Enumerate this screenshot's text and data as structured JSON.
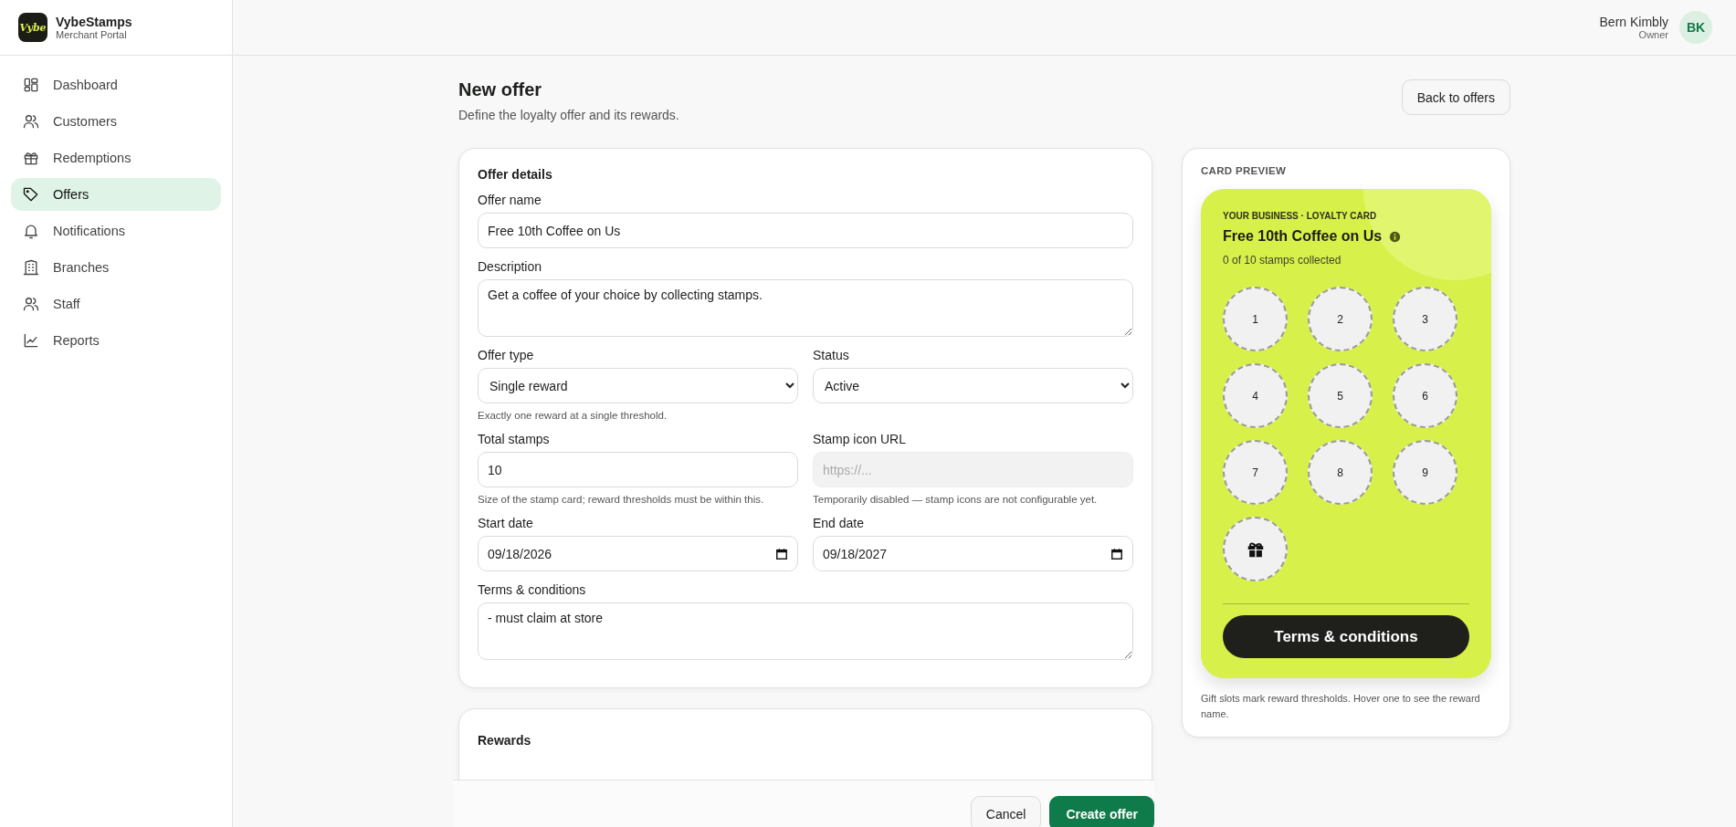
{
  "brand": {
    "logo_text": "Vybe",
    "name": "VybeStamps",
    "subtitle": "Merchant Portal"
  },
  "nav": [
    {
      "label": "Dashboard",
      "selected": false
    },
    {
      "label": "Customers",
      "selected": false
    },
    {
      "label": "Redemptions",
      "selected": false
    },
    {
      "label": "Offers",
      "selected": true
    },
    {
      "label": "Notifications",
      "selected": false
    },
    {
      "label": "Branches",
      "selected": false
    },
    {
      "label": "Staff",
      "selected": false
    },
    {
      "label": "Reports",
      "selected": false
    }
  ],
  "user": {
    "name": "Bern Kimbly",
    "role": "Owner",
    "initials": "BK"
  },
  "page": {
    "title": "New offer",
    "subtitle": "Define the loyalty offer and its rewards.",
    "back_button": "Back to offers"
  },
  "offer_details": {
    "title": "Offer details",
    "rows": [
      [
        {
          "kind": "text",
          "label": "Offer name",
          "value": "Free 10th Coffee on Us",
          "disabled": false
        }
      ],
      [
        {
          "kind": "textarea",
          "label": "Description",
          "value": "Get a coffee of your choice by collecting stamps.",
          "disabled": false
        }
      ],
      [
        {
          "kind": "select",
          "label": "Offer type",
          "value": "Single reward",
          "hint": "Exactly one reward at a single threshold.",
          "disabled": false
        },
        {
          "kind": "select",
          "label": "Status",
          "value": "Active",
          "disabled": false
        }
      ],
      [
        {
          "kind": "text",
          "label": "Total stamps",
          "value": "10",
          "hint": "Size of the stamp card; reward thresholds must be within this.",
          "disabled": false
        },
        {
          "kind": "text",
          "label": "Stamp icon URL",
          "placeholder": "https://...",
          "hint": "Temporarily disabled — stamp icons are not configurable yet.",
          "disabled": true
        }
      ],
      [
        {
          "kind": "date",
          "label": "Start date",
          "value": "09/18/2026",
          "disabled": false
        },
        {
          "kind": "date",
          "label": "End date",
          "value": "09/18/2027",
          "disabled": false
        }
      ],
      [
        {
          "kind": "textarea",
          "label": "Terms & conditions",
          "value": "- must claim at store",
          "disabled": false
        }
      ]
    ]
  },
  "rewards": {
    "title": "Rewards"
  },
  "actions": {
    "cancel": "Cancel",
    "create": "Create offer"
  },
  "preview": {
    "title": "CARD PREVIEW",
    "eyebrow": "YOUR BUSINESS · LOYALTY CARD",
    "name": "Free 10th Coffee on Us",
    "progress": "0 of 10 stamps collected",
    "slots": [
      {
        "kind": "number",
        "label": "1"
      },
      {
        "kind": "number",
        "label": "2"
      },
      {
        "kind": "number",
        "label": "3"
      },
      {
        "kind": "number",
        "label": "4"
      },
      {
        "kind": "number",
        "label": "5"
      },
      {
        "kind": "number",
        "label": "6"
      },
      {
        "kind": "number",
        "label": "7"
      },
      {
        "kind": "number",
        "label": "8"
      },
      {
        "kind": "number",
        "label": "9"
      },
      {
        "kind": "gift"
      }
    ],
    "terms_button": "Terms & conditions",
    "note": "Gift slots mark reward thresholds. Hover one to see the reward name."
  }
}
